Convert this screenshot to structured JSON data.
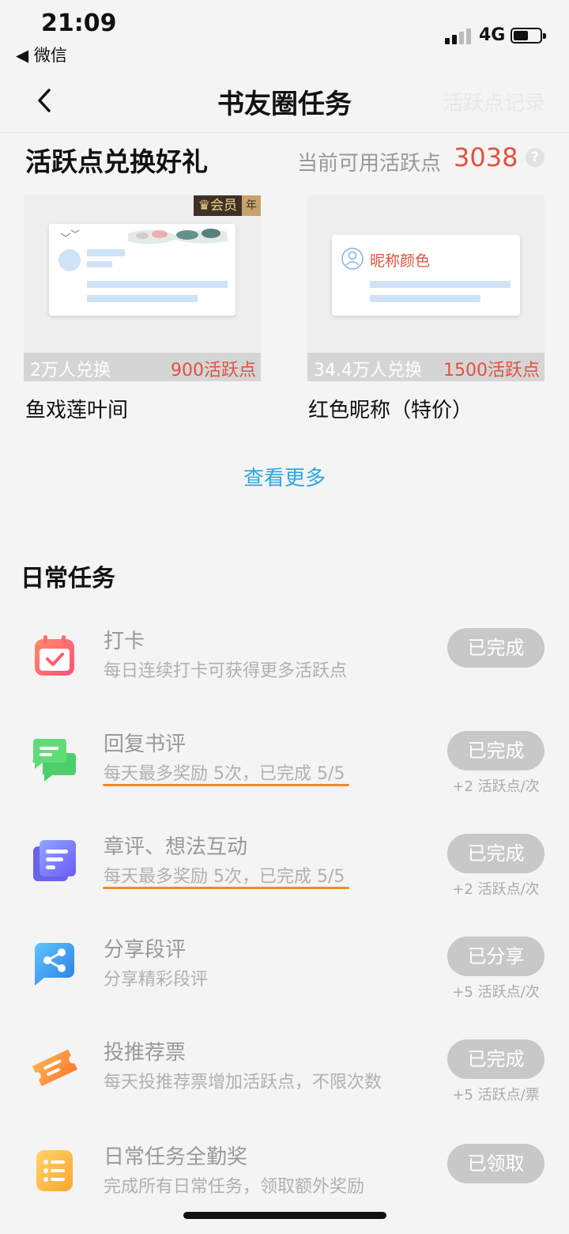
{
  "status": {
    "time": "21:09",
    "back_app": "◀ 微信",
    "network": "4G"
  },
  "nav": {
    "title": "书友圈任务",
    "right_link": "活跃点记录"
  },
  "exchange": {
    "title": "活跃点兑换好礼",
    "points_label": "当前可用活跃点",
    "points_value": "3038",
    "more": "查看更多",
    "items": [
      {
        "name": "鱼戏莲叶间",
        "count": "2万人兑换",
        "cost": "900活跃点",
        "badge_main": "会员",
        "badge_sub": "年"
      },
      {
        "name": "红色昵称（特价）",
        "count": "34.4万人兑换",
        "cost": "1500活跃点",
        "preview_label": "昵称颜色"
      }
    ]
  },
  "daily": {
    "title": "日常任务",
    "tasks": [
      {
        "name": "打卡",
        "desc": "每日连续打卡可获得更多活跃点",
        "button": "已完成",
        "reward": ""
      },
      {
        "name": "回复书评",
        "desc": "每天最多奖励 5次，已完成 5/5",
        "button": "已完成",
        "reward": "+2 活跃点/次"
      },
      {
        "name": "章评、想法互动",
        "desc": "每天最多奖励 5次，已完成 5/5",
        "button": "已完成",
        "reward": "+2 活跃点/次"
      },
      {
        "name": "分享段评",
        "desc": "分享精彩段评",
        "button": "已分享",
        "reward": "+5 活跃点/次"
      },
      {
        "name": "投推荐票",
        "desc": "每天投推荐票增加活跃点，不限次数",
        "button": "已完成",
        "reward": "+5 活跃点/票"
      },
      {
        "name": "日常任务全勤奖",
        "desc": "完成所有日常任务，领取额外奖励",
        "button": "已领取",
        "reward": ""
      }
    ]
  },
  "colors": {
    "accent_red": "#e0523f",
    "link_blue": "#2ea7e0",
    "progress_orange": "#f08a2b",
    "disabled_button": "#c8c8c8"
  },
  "icons": [
    "calendar-check-icon",
    "chat-bubbles-icon",
    "comment-card-icon",
    "share-icon",
    "ticket-icon",
    "list-icon",
    "crown-icon",
    "user-icon",
    "question-icon",
    "back-chevron-icon"
  ]
}
